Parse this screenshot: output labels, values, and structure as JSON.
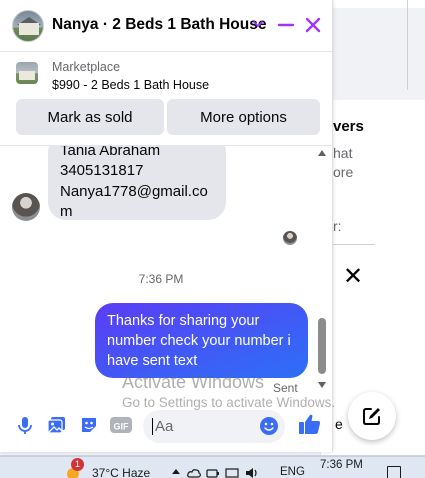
{
  "chat": {
    "title": "Nanya · 2 Beds 1 Bath House",
    "marketplace_label": "Marketplace",
    "listing": "$990 - 2 Beds 1 Bath House",
    "mark_sold_label": "Mark as sold",
    "more_options_label": "More options",
    "incoming_lines": [
      "Tania Abraham",
      "3405131817",
      "Nanya1778@gmail.co",
      "m"
    ],
    "timestamp": "7:36 PM",
    "outgoing_message": "Thanks for sharing your number check your number i have sent text",
    "sent_status": "Sent",
    "input_placeholder": "Aa",
    "accent_color": "#a033ff",
    "bubble_color": "#3f5cf6"
  },
  "background": {
    "card_title": "vers",
    "card_lines": [
      "hat",
      "ore"
    ],
    "card_field": "r:",
    "card_fragment": "e"
  },
  "watermark": {
    "title": "Activate Windows",
    "subtitle": "Go to Settings to activate Windows."
  },
  "taskbar": {
    "weather_badge": "1",
    "temperature": "37°C  Haze",
    "language": "ENG",
    "time": "7:36 PM"
  }
}
